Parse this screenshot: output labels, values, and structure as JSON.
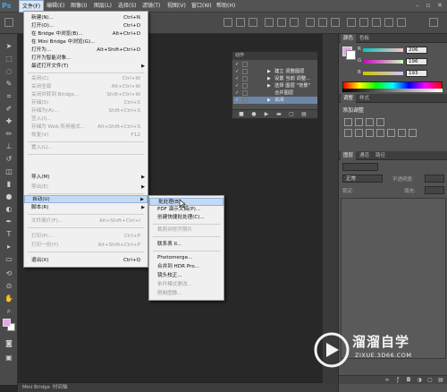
{
  "app": {
    "logo": "Ps"
  },
  "menubar": {
    "items": [
      "文件(F)",
      "编辑(E)",
      "图像(I)",
      "图层(L)",
      "选择(S)",
      "滤镜(T)",
      "视图(V)",
      "窗口(W)",
      "帮助(H)"
    ],
    "active_index": 0
  },
  "file_menu": {
    "items": [
      {
        "label": "新建(N)...",
        "shortcut": "Ctrl+N",
        "disabled": false
      },
      {
        "label": "打开(O)...",
        "shortcut": "Ctrl+O",
        "disabled": false
      },
      {
        "label": "在 Bridge 中浏览(B)...",
        "shortcut": "Alt+Ctrl+O",
        "disabled": false
      },
      {
        "label": "在 Mini Bridge 中浏览(G)...",
        "shortcut": "",
        "disabled": false
      },
      {
        "label": "打开为...",
        "shortcut": "Alt+Shift+Ctrl+O",
        "disabled": false
      },
      {
        "label": "打开为智能对象...",
        "shortcut": "",
        "disabled": false
      },
      {
        "label": "最近打开文件(T)",
        "shortcut": "",
        "disabled": false,
        "submenu": true
      },
      {
        "label": "关闭(C)",
        "shortcut": "Ctrl+W",
        "disabled": true
      },
      {
        "label": "关闭全部",
        "shortcut": "Alt+Ctrl+W",
        "disabled": true
      },
      {
        "label": "关闭并转到 Bridge...",
        "shortcut": "Shift+Ctrl+W",
        "disabled": true
      },
      {
        "label": "存储(S)",
        "shortcut": "Ctrl+S",
        "disabled": true
      },
      {
        "label": "存储为(A)...",
        "shortcut": "Shift+Ctrl+S",
        "disabled": true
      },
      {
        "label": "签入(I)...",
        "shortcut": "",
        "disabled": true
      },
      {
        "label": "存储为 Web 所用格式...",
        "shortcut": "Alt+Shift+Ctrl+S",
        "disabled": true
      },
      {
        "label": "恢复(V)",
        "shortcut": "F12",
        "disabled": true
      },
      {
        "label": "置入(L)...",
        "shortcut": "",
        "disabled": true
      },
      {
        "label": "导入(M)",
        "shortcut": "",
        "disabled": false,
        "submenu": true
      },
      {
        "label": "导出(E)",
        "shortcut": "",
        "disabled": true,
        "submenu": true
      },
      {
        "label": "自动(U)",
        "shortcut": "",
        "disabled": false,
        "submenu": true,
        "highlighted": true
      },
      {
        "label": "脚本(R)",
        "shortcut": "",
        "disabled": false,
        "submenu": true
      },
      {
        "label": "文件简介(F)...",
        "shortcut": "Alt+Shift+Ctrl+I",
        "disabled": true
      },
      {
        "label": "打印(P)...",
        "shortcut": "Ctrl+P",
        "disabled": true
      },
      {
        "label": "打印一份(Y)",
        "shortcut": "Alt+Shift+Ctrl+P",
        "disabled": true
      },
      {
        "label": "退出(X)",
        "shortcut": "Ctrl+Q",
        "disabled": false
      }
    ]
  },
  "automate_submenu": {
    "items": [
      {
        "label": "批处理(B)...",
        "disabled": false,
        "highlighted": true
      },
      {
        "label": "PDF 演示文稿(P)...",
        "disabled": false
      },
      {
        "label": "创建快捷批处理(C)...",
        "disabled": false
      },
      {
        "label": "裁剪并修齐照片",
        "disabled": true
      },
      {
        "label": "联系表 II...",
        "disabled": false
      },
      {
        "label": "Photomerge...",
        "disabled": false
      },
      {
        "label": "合并到 HDR Pro...",
        "disabled": false
      },
      {
        "label": "镜头校正...",
        "disabled": false
      },
      {
        "label": "条件模式更改...",
        "disabled": true
      },
      {
        "label": "限制图像...",
        "disabled": true
      }
    ]
  },
  "actions_panel": {
    "tab": "动作",
    "rows": [
      {
        "text": "",
        "checked": true,
        "expander": false,
        "selected": false
      },
      {
        "text": "建立 调整图层",
        "checked": true,
        "expander": true,
        "selected": false
      },
      {
        "text": "设置 当前 调整...",
        "checked": true,
        "expander": true,
        "selected": false
      },
      {
        "text": "选择 图层 \"背景\"",
        "checked": true,
        "expander": true,
        "selected": false
      },
      {
        "text": "合并图层",
        "checked": true,
        "expander": false,
        "selected": false
      },
      {
        "text": "关闭",
        "checked": true,
        "expander": true,
        "selected": true
      }
    ]
  },
  "color_panel": {
    "tabs": [
      "颜色",
      "色板"
    ],
    "fg_color": "#e6a7e4",
    "channels": [
      {
        "label": "R",
        "value": "206"
      },
      {
        "label": "G",
        "value": "196"
      },
      {
        "label": "B",
        "value": "193"
      }
    ]
  },
  "adjust_panel": {
    "tabs": [
      "调整",
      "样式"
    ],
    "title": "添加调整"
  },
  "layers_panel": {
    "tabs": [
      "图层",
      "通道",
      "路径"
    ],
    "blend_mode": "正常",
    "opacity_label": "不透明度:",
    "lock_label": "锁定:",
    "fill_label": "填充:"
  },
  "status_bar": {
    "tabs": [
      "Mini Bridge",
      "时间轴"
    ]
  },
  "watermark": {
    "title": "溜溜自学",
    "url": "ZIXUE.3D66.COM"
  }
}
